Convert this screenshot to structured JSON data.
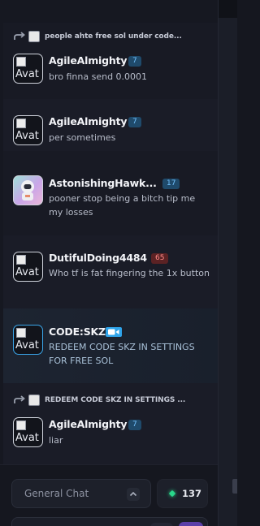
{
  "chat": {
    "messages": [
      {
        "reply_to": "people ahte free sol under code...",
        "username": "AgileAlmighty",
        "level": "7",
        "level_color": "#74c3ff",
        "avatar_alt": "Avat",
        "text": "bro finna send 0.0001"
      },
      {
        "username": "AgileAlmighty",
        "level": "7",
        "level_color": "#74c3ff",
        "avatar_alt": "Avat",
        "text": "per sometimes"
      },
      {
        "username": "AstonishingHawk...",
        "level": "17",
        "level_color": "#74c3ff",
        "avatar_alt": "",
        "text": "pooner stop being a bitch tip me my losses"
      },
      {
        "username": "DutifulDoing4484",
        "level": "65",
        "level_color": "#ff8a87",
        "avatar_alt": "Avat",
        "text": "Who tf is fat fingering the 1x button"
      },
      {
        "username": "CODE:SKZ",
        "badge": "video-camera-icon",
        "badge_color": "#2fa4ea",
        "avatar_alt": "Avat",
        "text": "REDEEM CODE SKZ IN SETTINGS FOR FREE SOL"
      },
      {
        "reply_to": "REDEEM CODE SKZ IN SETTINGS ...",
        "username": "AgileAlmighty",
        "level": "7",
        "level_color": "#74c3ff",
        "avatar_alt": "Avat",
        "text": "liar"
      }
    ]
  },
  "footer": {
    "channel": "General Chat",
    "channel_caret": "chevron-up-icon",
    "online_icon": "online-diamond-icon",
    "online_color": "#29d78b",
    "online_count": "137"
  }
}
